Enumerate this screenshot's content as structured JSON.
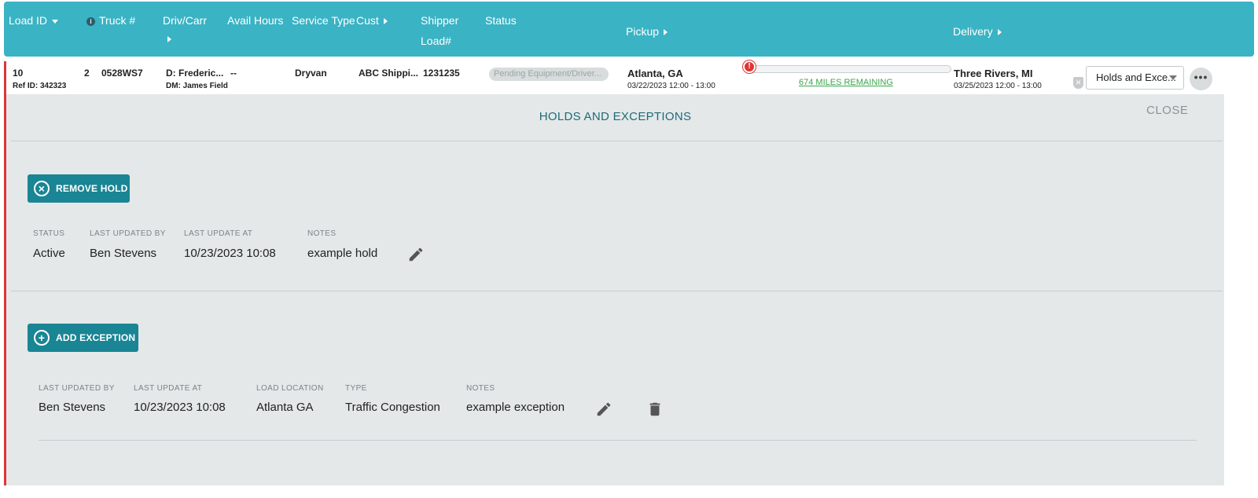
{
  "header": {
    "load_id": "Load ID",
    "truck": "Truck #",
    "driv_carr": "Driv/Carr",
    "avail_hours": "Avail Hours",
    "service_type": "Service Type",
    "cust": "Cust",
    "shipper": "Shipper",
    "load_num": "Load#",
    "status": "Status",
    "pickup": "Pickup",
    "delivery": "Delivery"
  },
  "load_row": {
    "load_id": "10",
    "ref_id": "Ref ID: 342323",
    "count": "2",
    "truck": "0528WS7",
    "driver": "D: Frederic...",
    "dm": "DM: James Field",
    "avail_hours": "--",
    "service_type": "Dryvan",
    "customer": "ABC Shippi...",
    "shipper_load": "1231235",
    "status": "Pending Equipment/Driver...",
    "pickup_city": "Atlanta, GA",
    "pickup_time": "03/22/2023 12:00 - 13:00",
    "miles_remaining": "674 MILES REMAINING",
    "delivery_city": "Three Rivers, MI",
    "delivery_time": "03/25/2023 12:00 - 13:00",
    "holds_select": "Holds and Exce..."
  },
  "panel": {
    "title": "HOLDS AND EXCEPTIONS",
    "close": "CLOSE"
  },
  "hold": {
    "button": "REMOVE HOLD",
    "labels": {
      "status": "STATUS",
      "updated_by": "LAST UPDATED BY",
      "update_at": "LAST UPDATE AT",
      "notes": "NOTES"
    },
    "values": {
      "status": "Active",
      "updated_by": "Ben Stevens",
      "update_at": "10/23/2023 10:08",
      "notes": "example hold"
    }
  },
  "exception": {
    "button": "ADD EXCEPTION",
    "labels": {
      "updated_by": "LAST UPDATED BY",
      "update_at": "LAST UPDATE AT",
      "location": "LOAD LOCATION",
      "type": "TYPE",
      "notes": "NOTES"
    },
    "values": {
      "updated_by": "Ben Stevens",
      "update_at": "10/23/2023 10:08",
      "location": "Atlanta GA",
      "type": "Traffic Congestion",
      "notes": "example exception"
    }
  },
  "icons": {
    "info": "info-icon",
    "alert": "alert-icon",
    "shield": "shield-icon",
    "more": "more-icon",
    "remove": "close-circle-icon",
    "add": "plus-circle-icon",
    "edit": "pencil-icon",
    "delete": "trash-icon"
  },
  "colors": {
    "header": "#3ab3c4",
    "button": "#1a8594",
    "accent_border": "#d9373a",
    "miles": "#3aa64b"
  }
}
